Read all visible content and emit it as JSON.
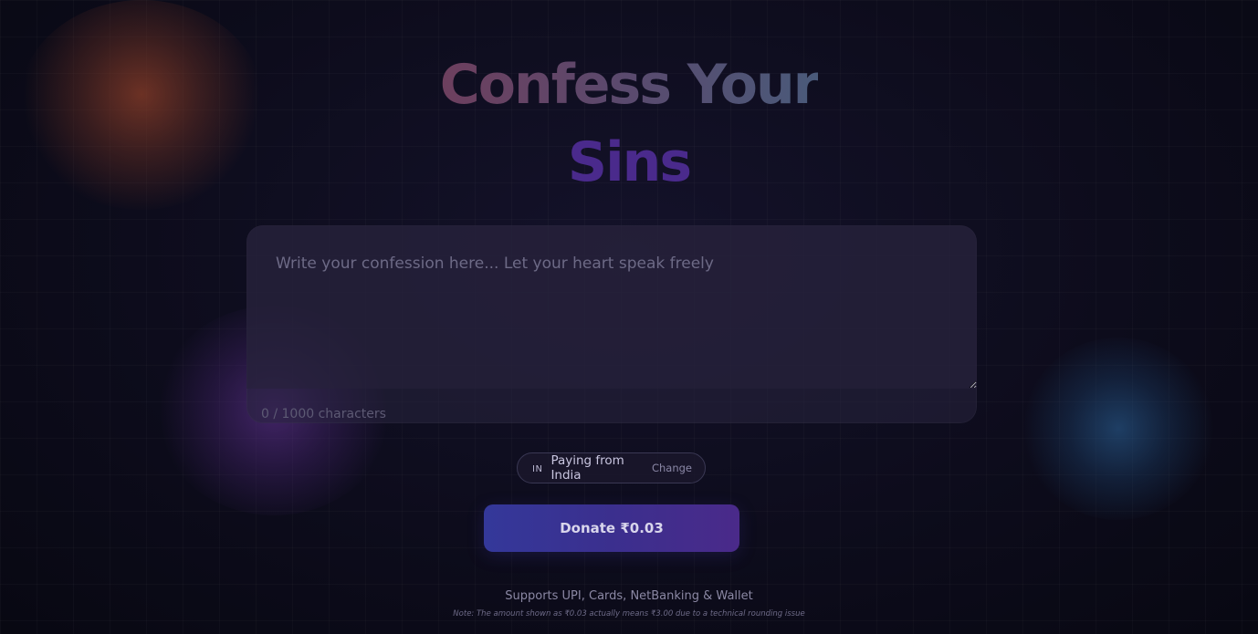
{
  "hero": {
    "title_line1": "Confess Your",
    "title_line2": "Sins"
  },
  "confession": {
    "placeholder": "Write your confession here... Let your heart speak freely",
    "value": "",
    "char_count": "0 / 1000 characters"
  },
  "country": {
    "code": "IN",
    "label": "Paying from India",
    "change_label": "Change"
  },
  "donate": {
    "label": "Donate ₹0.03"
  },
  "footer": {
    "supports": "Supports UPI, Cards, NetBanking & Wallet",
    "note": "Note: The amount shown as ₹0.03 actually means ₹3.00 due to a technical rounding issue"
  },
  "colors": {
    "background": "#0b0a16",
    "accent_purple": "#4a2a8c",
    "button_start": "#34389a",
    "button_end": "#4a2a8a"
  }
}
